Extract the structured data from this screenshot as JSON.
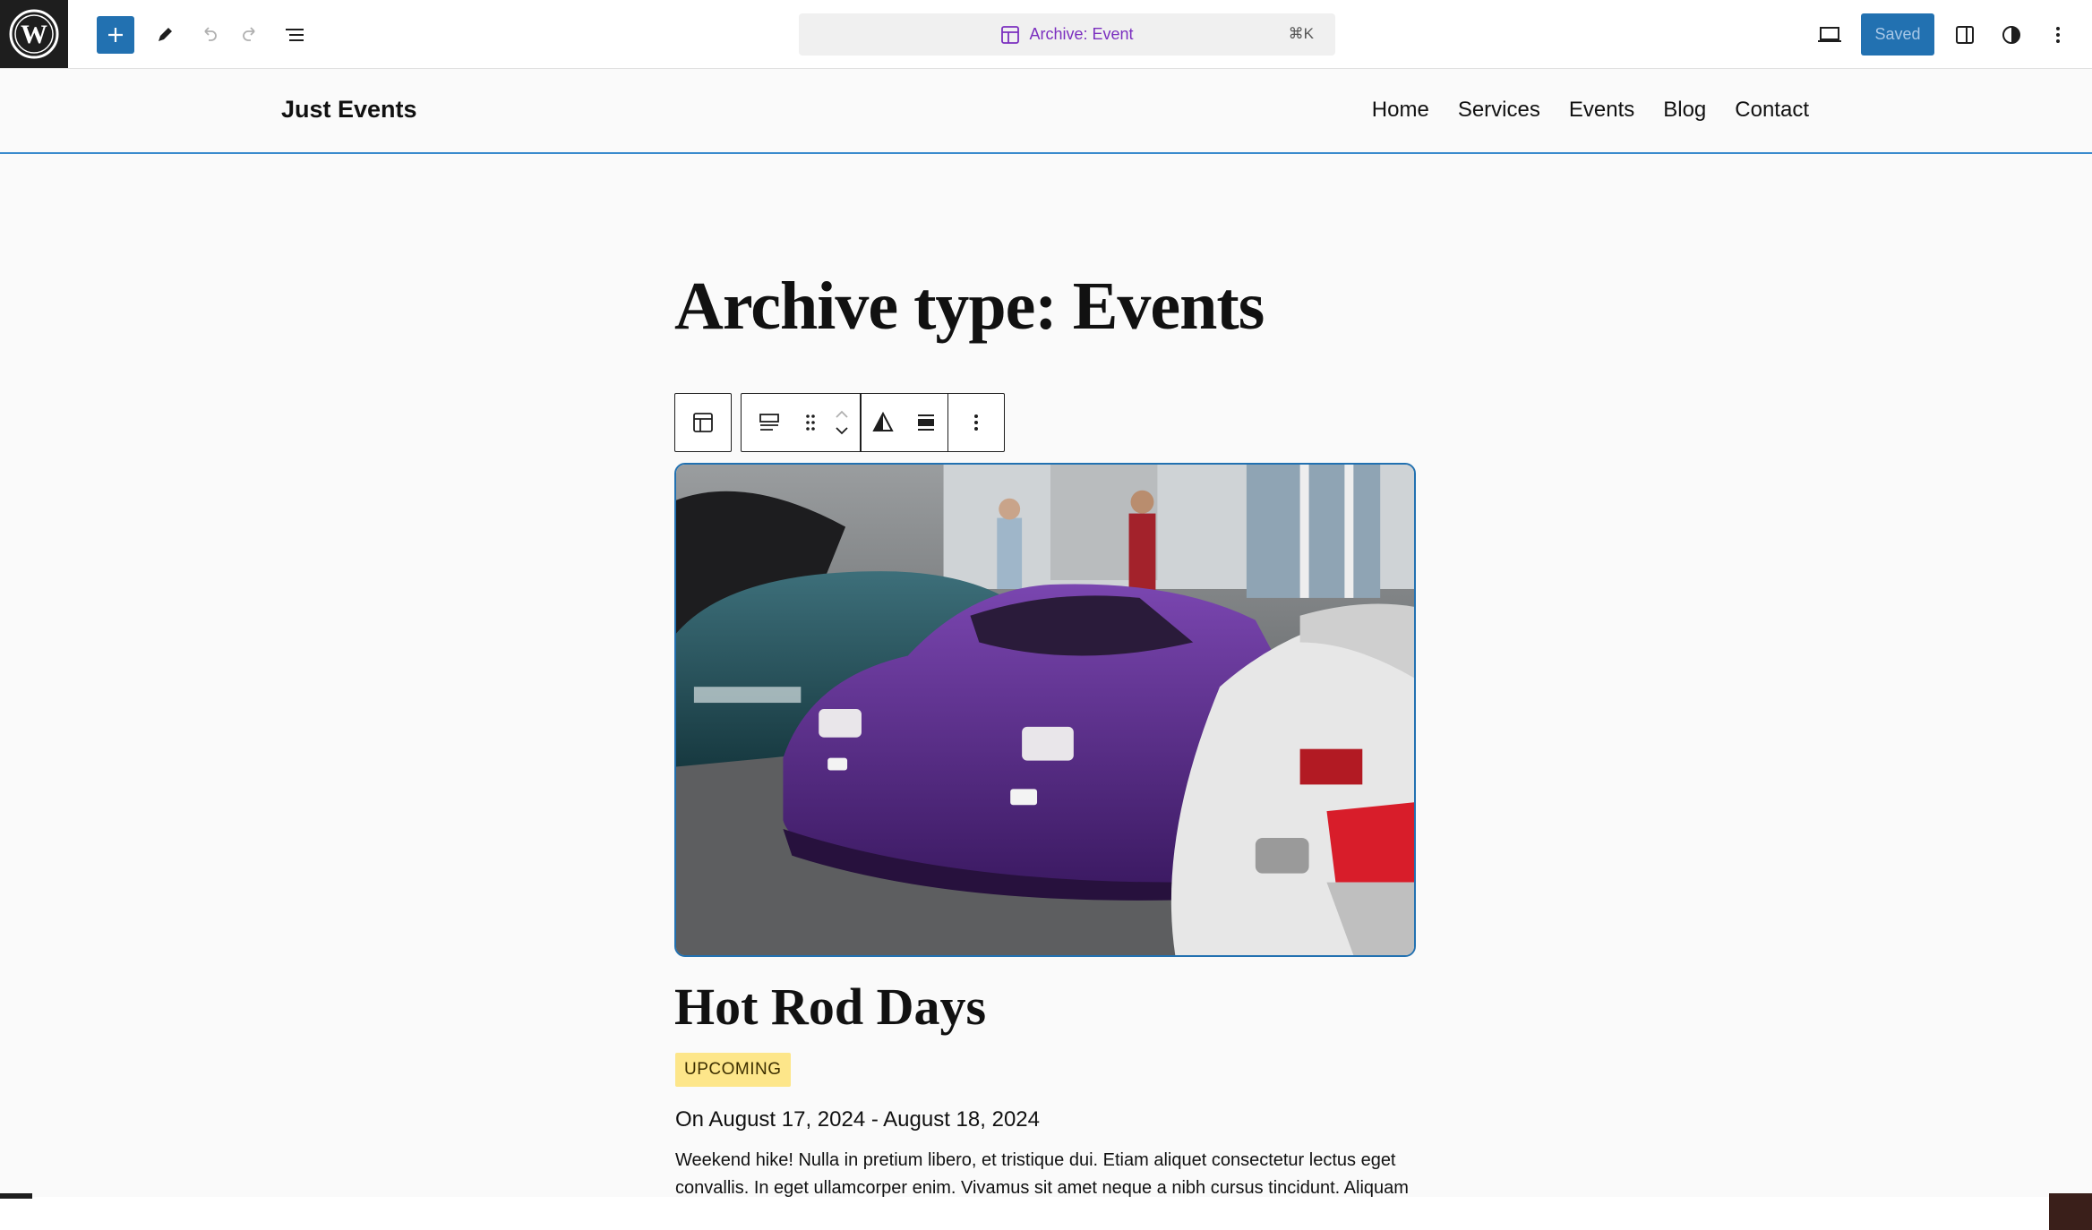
{
  "editor": {
    "command_center": {
      "template_label": "Archive: Event",
      "shortcut": "⌘K"
    },
    "saved_label": "Saved"
  },
  "site": {
    "title": "Just Events",
    "nav": [
      "Home",
      "Services",
      "Events",
      "Blog",
      "Contact"
    ]
  },
  "content": {
    "archive_title": "Archive type: Events",
    "event": {
      "title": "Hot Rod Days",
      "status": "UPCOMING",
      "date": "On August 17, 2024 - August 18, 2024",
      "description": "Weekend hike! Nulla in pretium libero, et tristique dui. Etiam aliquet consectetur lectus eget convallis. In eget ullamcorper enim. Vivamus sit amet neque a nibh cursus tincidunt. Aliquam eget justo quis nibh pretium viverra. Aenean pretium nulla commodo est varius"
    }
  },
  "colors": {
    "accent": "#2271b1",
    "template_purple": "#7b2fbf",
    "badge_bg": "#fde68a",
    "car_purple": "#5b2a86"
  },
  "icons": {
    "wp_logo": "wordpress-logo-icon",
    "add": "plus-icon",
    "tools": "pencil-icon",
    "undo": "undo-icon",
    "redo": "redo-icon",
    "list_view": "list-view-icon",
    "template": "layout-icon",
    "view": "laptop-icon",
    "settings": "sidebar-icon",
    "styles": "half-circle-icon",
    "options": "vertical-ellipsis-icon"
  }
}
